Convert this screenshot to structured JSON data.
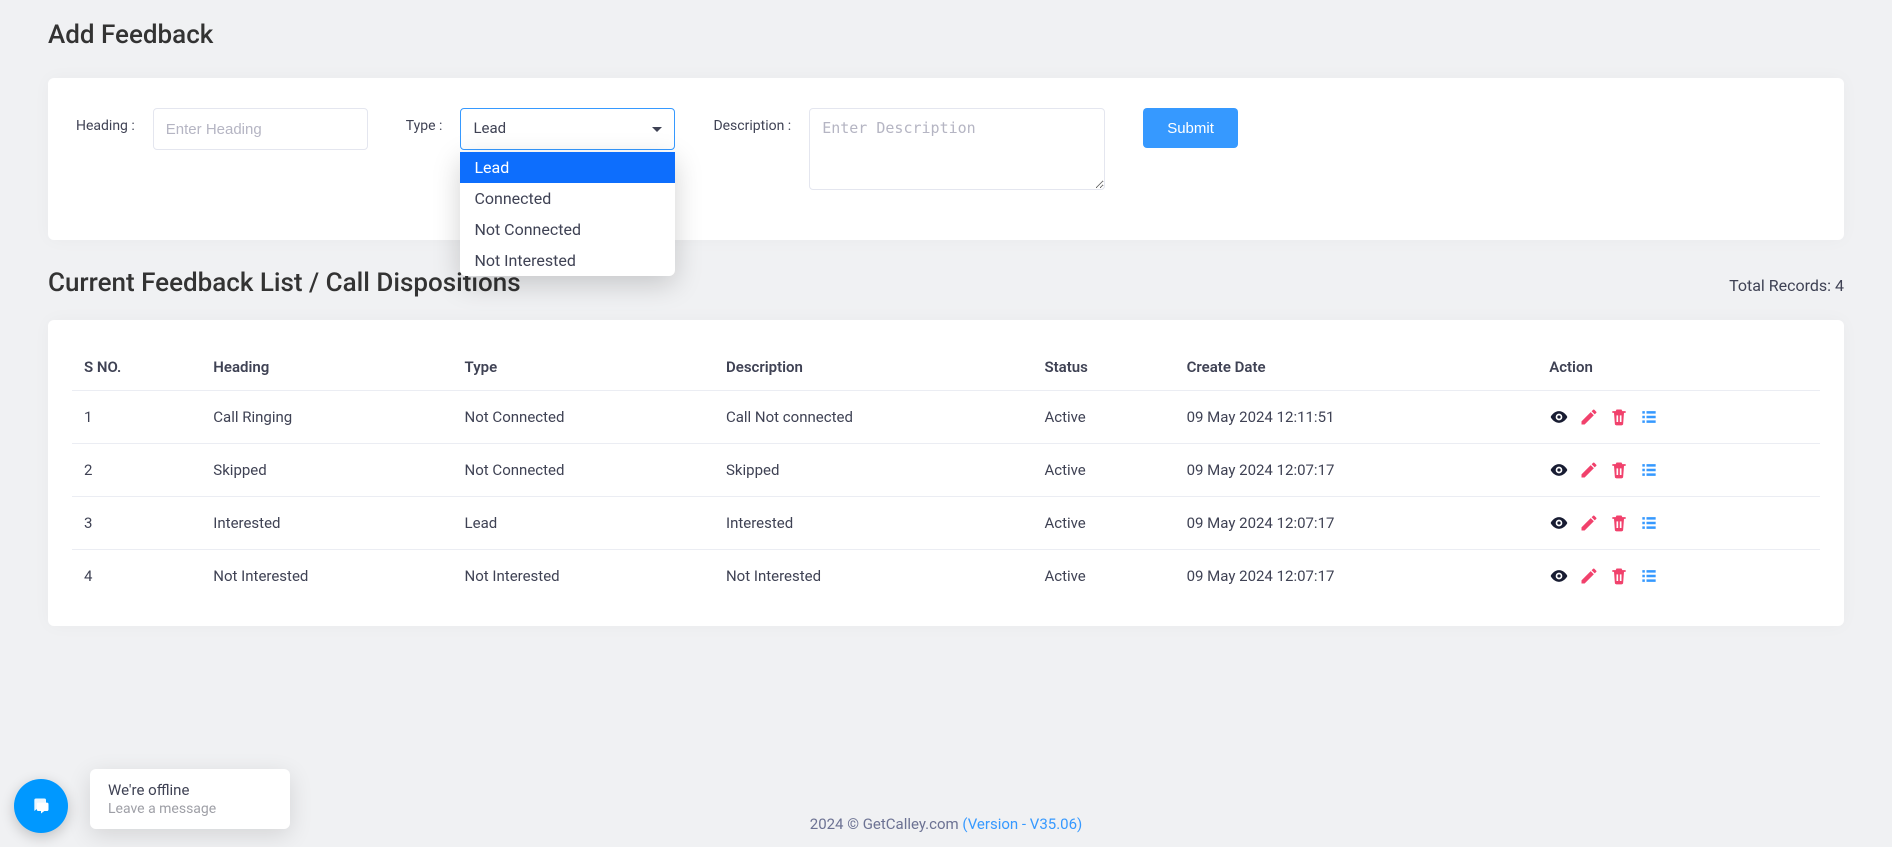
{
  "page": {
    "title": "Add Feedback"
  },
  "form": {
    "heading_label": "Heading :",
    "heading_placeholder": "Enter Heading",
    "type_label": "Type :",
    "type_selected": "Lead",
    "type_options": [
      "Lead",
      "Connected",
      "Not Connected",
      "Not Interested"
    ],
    "type_selected_index": 0,
    "description_label": "Description :",
    "description_placeholder": "Enter Description",
    "submit_label": "Submit"
  },
  "list": {
    "title": "Current Feedback List / Call Dispositions",
    "total_records_label": "Total Records: 4",
    "columns": [
      "S NO.",
      "Heading",
      "Type",
      "Description",
      "Status",
      "Create Date",
      "Action"
    ],
    "rows": [
      {
        "sno": "1",
        "heading": "Call Ringing",
        "type": "Not Connected",
        "description": "Call Not connected",
        "status": "Active",
        "create_date": "09 May 2024 12:11:51"
      },
      {
        "sno": "2",
        "heading": "Skipped",
        "type": "Not Connected",
        "description": "Skipped",
        "status": "Active",
        "create_date": "09 May 2024 12:07:17"
      },
      {
        "sno": "3",
        "heading": "Interested",
        "type": "Lead",
        "description": "Interested",
        "status": "Active",
        "create_date": "09 May 2024 12:07:17"
      },
      {
        "sno": "4",
        "heading": "Not Interested",
        "type": "Not Interested",
        "description": "Not Interested",
        "status": "Active",
        "create_date": "09 May 2024 12:07:17"
      }
    ]
  },
  "footer": {
    "copyright": "2024 © GetCalley.com ",
    "version": "(Version - V35.06)"
  },
  "chat": {
    "status": "We're offline",
    "prompt": "Leave a message"
  },
  "colors": {
    "primary": "#3699ff",
    "dropdown_highlight": "#0d6efd",
    "action_view": "#181c32",
    "action_edit": "#f1416c",
    "action_delete": "#f1416c",
    "action_list": "#3699ff"
  }
}
